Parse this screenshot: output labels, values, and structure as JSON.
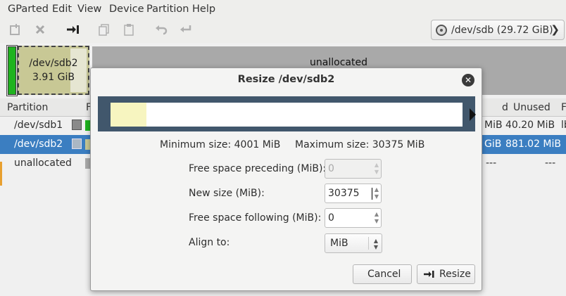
{
  "menubar": {
    "items": [
      "GParted",
      "Edit",
      "View",
      "Device",
      "Partition",
      "Help"
    ]
  },
  "toolbar": {
    "icons": [
      "new-icon",
      "delete-icon",
      "resize-move-icon",
      "copy-icon",
      "paste-icon",
      "undo-icon",
      "apply-icon"
    ]
  },
  "device_selector": {
    "label": "/dev/sdb   (29.72 GiB)"
  },
  "graph": {
    "sdb2_name": "/dev/sdb2",
    "sdb2_size": "3.91 GiB",
    "unallocated": "unallocated"
  },
  "table": {
    "headers": [
      "Partition",
      "F",
      "d",
      "Unused",
      "F"
    ],
    "rows": [
      {
        "partition": "/dev/sdb1",
        "used_tail": "MiB",
        "unused": "40.20 MiB",
        "flags": "lb",
        "selected": false,
        "color": "#1fb31f"
      },
      {
        "partition": "/dev/sdb2",
        "used_tail": "GiB",
        "unused": "881.02 MiB",
        "flags": "",
        "selected": true,
        "color": "#c8c895"
      },
      {
        "partition": "unallocated",
        "used_tail": "---",
        "unused": "---",
        "flags": "",
        "selected": false,
        "color": "#a9a9a9"
      }
    ]
  },
  "dialog": {
    "title": "Resize /dev/sdb2",
    "min_size": "Minimum size: 4001 MiB",
    "max_size": "Maximum size: 30375 MiB",
    "free_preceding_label": "Free space preceding (MiB):",
    "free_preceding_value": "0",
    "new_size_label": "New size (MiB):",
    "new_size_value": "30375",
    "free_following_label": "Free space following (MiB):",
    "free_following_value": "0",
    "align_label": "Align to:",
    "align_value": "MiB",
    "cancel_label": "Cancel",
    "resize_label": "Resize"
  },
  "colors": {
    "selection": "#3b7ec1",
    "resize_frame": "#41576c",
    "used_space": "#f7f5c0"
  }
}
